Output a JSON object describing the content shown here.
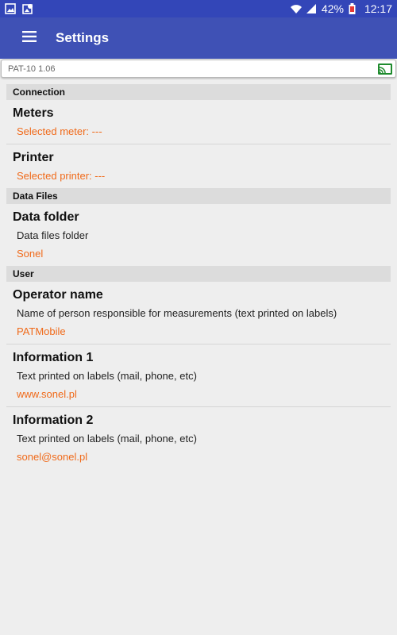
{
  "status_bar": {
    "battery": "42%",
    "time": "12:17",
    "icons": [
      "gallery-icon",
      "photo-editor-icon",
      "wifi-icon",
      "signal-icon",
      "battery-icon"
    ]
  },
  "app_bar": {
    "title": "Settings",
    "menu_icon": "hamburger-menu-icon"
  },
  "device_bar": {
    "name": "PAT-10 1.06",
    "cast_icon": "cast-icon",
    "accent_color": "#1f8b2e"
  },
  "colors": {
    "primary": "#3f51b5",
    "primary_dark": "#3346b8",
    "accent": "#f06a1a",
    "section_bg": "#dcdcdc"
  },
  "sections": {
    "connection": {
      "header": "Connection",
      "meters": {
        "title": "Meters",
        "value": "Selected meter: ---"
      },
      "printer": {
        "title": "Printer",
        "value": "Selected printer: ---"
      }
    },
    "data_files": {
      "header": "Data Files",
      "data_folder": {
        "title": "Data folder",
        "summary": "Data files folder",
        "value": "Sonel"
      }
    },
    "user": {
      "header": "User",
      "operator_name": {
        "title": "Operator name",
        "summary": "Name of person responsible for measurements (text printed on labels)",
        "value": "PATMobile"
      },
      "information_1": {
        "title": "Information 1",
        "summary": "Text printed on labels (mail, phone, etc)",
        "value": "www.sonel.pl"
      },
      "information_2": {
        "title": "Information 2",
        "summary": "Text printed on labels (mail, phone, etc)",
        "value": "sonel@sonel.pl"
      }
    }
  }
}
